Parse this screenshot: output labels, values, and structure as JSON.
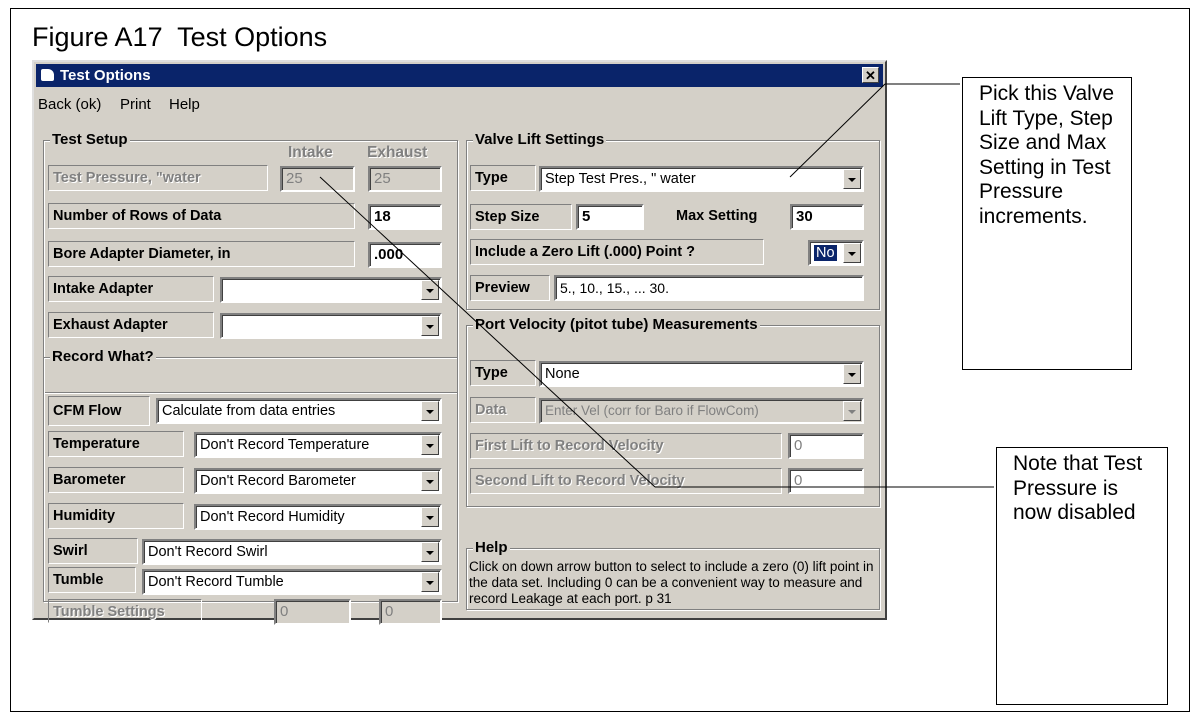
{
  "figure": {
    "title": "Figure A17  Test Options"
  },
  "window": {
    "title": "Test Options",
    "close_label": "✕"
  },
  "menu": [
    "Back (ok)",
    "Print",
    "Help"
  ],
  "test_setup": {
    "legend": "Test Setup",
    "col_intake": "Intake",
    "col_exhaust": "Exhaust",
    "test_pressure": {
      "label": "Test Pressure, \"water",
      "intake": "25",
      "exhaust": "25"
    },
    "rows_of_data": {
      "label": "Number of Rows of Data",
      "value": "18"
    },
    "bore_adapter": {
      "label": "Bore Adapter Diameter, in",
      "value": ".000"
    },
    "intake_adapter": {
      "label": "Intake Adapter",
      "value": ""
    },
    "exhaust_adapter": {
      "label": "Exhaust Adapter",
      "value": ""
    }
  },
  "record_what": {
    "legend": "Record What?",
    "cfm_flow": {
      "label": "CFM Flow",
      "value": "Calculate from data entries"
    },
    "temperature": {
      "label": "Temperature",
      "value": "Don't Record Temperature"
    },
    "barometer": {
      "label": "Barometer",
      "value": "Don't Record Barometer"
    },
    "humidity": {
      "label": "Humidity",
      "value": "Don't Record Humidity"
    },
    "swirl": {
      "label": "Swirl",
      "value": "Don't Record Swirl"
    },
    "tumble": {
      "label": "Tumble",
      "value": "Don't Record Tumble"
    },
    "tumble_settings": {
      "label": "Tumble Settings",
      "value1": "0",
      "value2": "0"
    }
  },
  "valve_lift": {
    "legend": "Valve Lift Settings",
    "type_label": "Type",
    "type_value": "Step Test Pres., \" water",
    "step_size_label": "Step Size",
    "step_size_value": "5",
    "max_setting_label": "Max Setting",
    "max_setting_value": "30",
    "zero_lift_label": "Include a Zero Lift (.000) Point ?",
    "zero_lift_value": "No",
    "preview_label": "Preview",
    "preview_value": "5., 10., 15., ... 30."
  },
  "port_velocity": {
    "legend": "Port Velocity (pitot tube) Measurements",
    "type_label": "Type",
    "type_value": "None",
    "data_label": "Data",
    "data_value": "Enter Vel (corr for Baro if FlowCom)",
    "first_lift_label": "First Lift to Record Velocity",
    "first_lift_value": "0",
    "second_lift_label": "Second Lift to Record Velocity",
    "second_lift_value": "0"
  },
  "help": {
    "legend": "Help",
    "text": "Click on down arrow button to select to include a zero (0) lift point in the data set.  Including 0 can be a convenient way to measure and record Leakage at each port.  p 31"
  },
  "callouts": [
    {
      "text": "Pick this Valve Lift Type, Step Size and Max Setting in Test Pressure increments."
    },
    {
      "text": "Note that Test Pressure is now disabled"
    }
  ]
}
